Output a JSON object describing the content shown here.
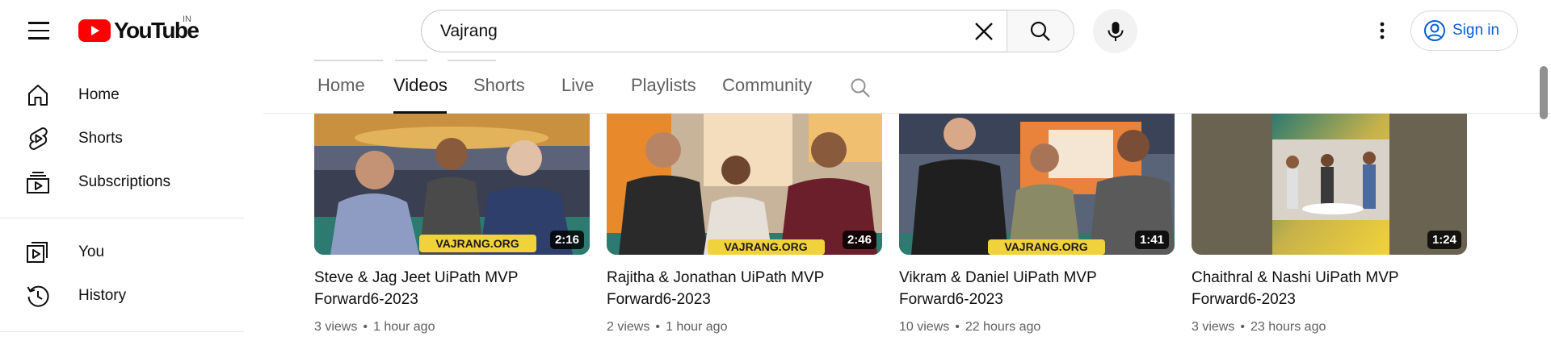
{
  "header": {
    "logo_text": "YouTube",
    "country_code": "IN",
    "search_value": "Vajrang",
    "search_placeholder": "Search",
    "signin_label": "Sign in",
    "brand_red": "#FF0000",
    "link_blue": "#065fd4"
  },
  "sidebar": {
    "items": [
      {
        "label": "Home",
        "icon": "home-icon"
      },
      {
        "label": "Shorts",
        "icon": "shorts-icon"
      },
      {
        "label": "Subscriptions",
        "icon": "subscriptions-icon"
      },
      {
        "label": "You",
        "icon": "you-icon"
      },
      {
        "label": "History",
        "icon": "history-icon"
      }
    ]
  },
  "tabs": {
    "items": [
      "Home",
      "Videos",
      "Shorts",
      "Live",
      "Playlists",
      "Community"
    ],
    "active": "Videos"
  },
  "videos": [
    {
      "title": "Steve & Jag Jeet UiPath MVP Forward6-2023",
      "duration": "2:16",
      "views": "3 views",
      "age": "1 hour ago"
    },
    {
      "title": "Rajitha & Jonathan UiPath MVP Forward6-2023",
      "duration": "2:46",
      "views": "2 views",
      "age": "1 hour ago"
    },
    {
      "title": "Vikram & Daniel UiPath MVP Forward6-2023",
      "duration": "1:41",
      "views": "10 views",
      "age": "22 hours ago"
    },
    {
      "title": "Chaithral & Nashi UiPath MVP Forward6-2023",
      "duration": "1:24",
      "views": "3 views",
      "age": "23 hours ago"
    }
  ],
  "watermark_text": "VAJRANG.ORG"
}
